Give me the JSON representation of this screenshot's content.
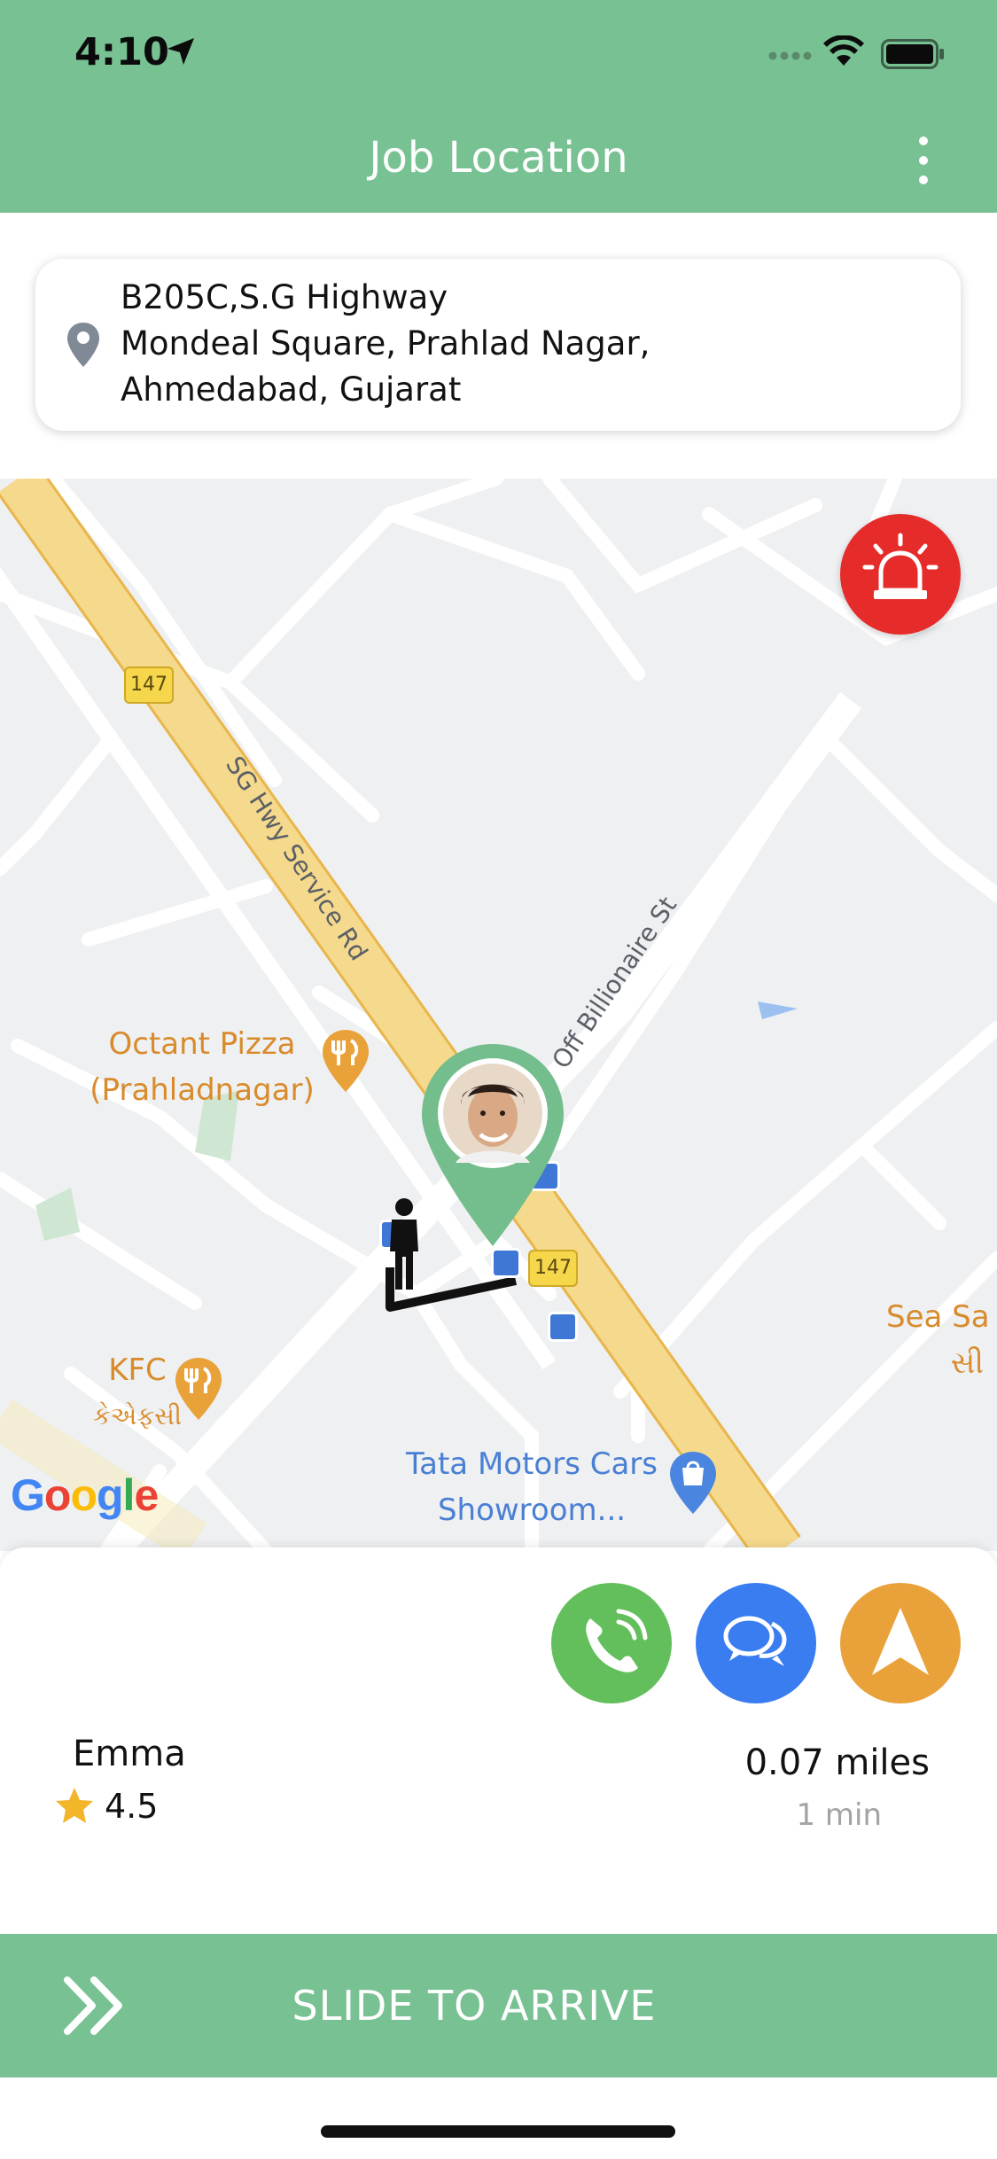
{
  "status_bar": {
    "time": "4:10"
  },
  "header": {
    "title": "Job Location"
  },
  "address": {
    "line1": "B205C,S.G Highway",
    "line2": "Mondeal Square, Prahlad Nagar,",
    "line3": "Ahmedabad, Gujarat"
  },
  "map": {
    "places": {
      "octant_line1": "Octant Pizza",
      "octant_line2": "(Prahladnagar)",
      "kfc_line1": "KFC",
      "kfc_line2": "કેએફસી",
      "tata_line1": "Tata Motors Cars",
      "tata_line2": "Showroom...",
      "sea_line1": "Sea Sa",
      "sea_line2": "સી"
    },
    "roads": {
      "sg_service": "SG Hwy Service Rd",
      "off_billionaire": "Off Billionaire St"
    },
    "route_shields": [
      "147",
      "147"
    ],
    "google_logo": "Google",
    "colors": {
      "highway": "#f5d98c",
      "highway_edge": "#e8b64b",
      "pin": "#74bd8c",
      "alarm": "#e62b2b"
    }
  },
  "driver": {
    "name": "Emma",
    "rating": "4.5",
    "distance": "0.07 miles",
    "eta": "1 min"
  },
  "actions": {
    "call_icon": "phone-icon",
    "chat_icon": "chat-icon",
    "navigate_icon": "navigation-arrow-icon"
  },
  "slide": {
    "label": "SLIDE TO ARRIVE"
  }
}
